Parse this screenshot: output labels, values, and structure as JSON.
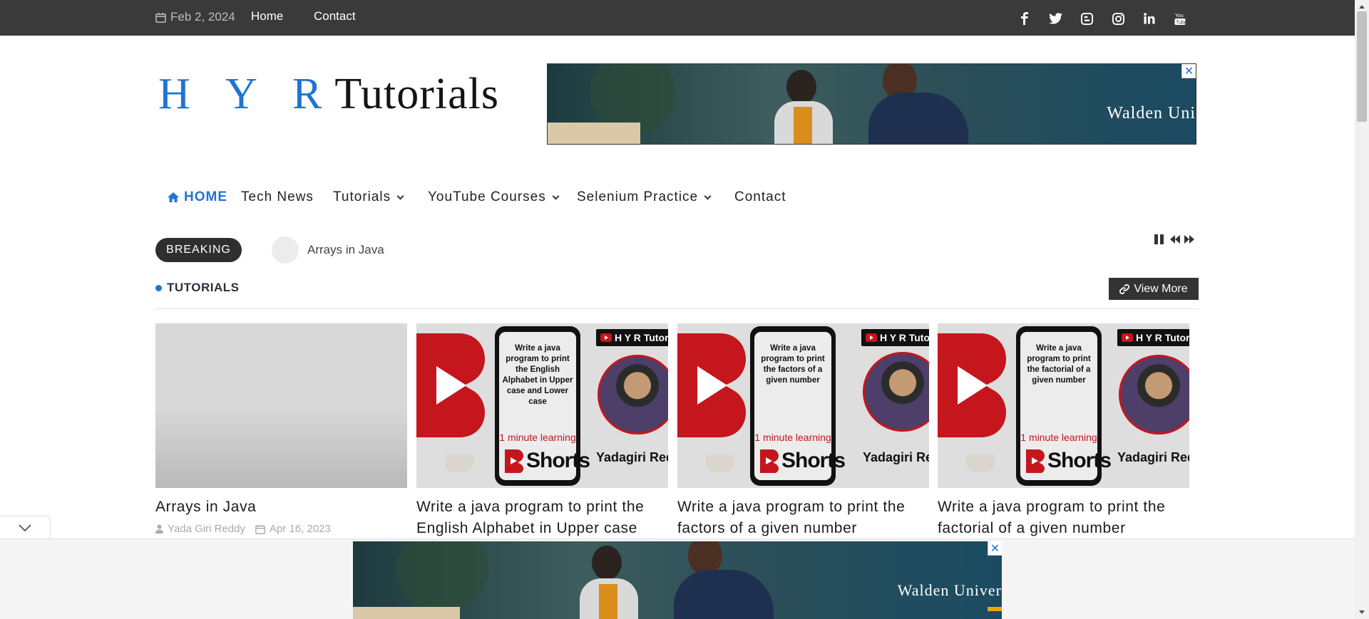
{
  "topbar": {
    "date": "Feb 2, 2024",
    "links": [
      "Home",
      "Contact"
    ],
    "social_icons": [
      "facebook-icon",
      "twitter-icon",
      "blogger-icon",
      "instagram-icon",
      "linkedin-icon",
      "youtube-icon"
    ]
  },
  "header": {
    "logo_letters": "H Y R",
    "logo_word": "Tutorials",
    "ad_brand": "Walden Uni",
    "ad_close": "✕"
  },
  "nav": {
    "items": [
      {
        "label": "HOME",
        "active": true
      },
      {
        "label": "Tech News"
      },
      {
        "label": "Tutorials"
      },
      {
        "label": "YouTube Courses"
      },
      {
        "label": "Selenium Practice"
      },
      {
        "label": "Contact"
      }
    ]
  },
  "breaking": {
    "label": "BREAKING",
    "text": "Arrays in Java"
  },
  "section": {
    "title": "TUTORIALS",
    "view_more": "View More"
  },
  "cards": [
    {
      "title": "Arrays in Java",
      "author": "Yada Giri Reddy",
      "date": "Apr 16, 2023"
    },
    {
      "title": "Write a java program to print the English Alphabet in Upper case",
      "thumb_text": "Write a java program to print the English Alphabet in Upper case and Lower case",
      "one_min": "1 minute learning",
      "shorts": "Shorts",
      "badge": "H Y R Tutorials",
      "owner": "Yadagiri Reddy"
    },
    {
      "title": "Write a java program to print the factors of a given number",
      "thumb_text": "Write a java program to print the factors of a given number",
      "one_min": "1 minute learning",
      "shorts": "Shorts",
      "badge": "H Y R Tutorials",
      "owner": "Yadagiri Reddy"
    },
    {
      "title": "Write a java program to print the factorial of a given number",
      "thumb_text": "Write a java program to print the factorial of a given number",
      "one_min": "1 minute learning",
      "shorts": "Shorts",
      "badge": "H Y R Tutorials",
      "owner": "Yadagiri Reddy"
    }
  ],
  "bottom_ad": {
    "brand": "Walden Univer",
    "close": "✕"
  },
  "colors": {
    "accent": "#1f74d1",
    "topbar": "#3a3a3a",
    "youtube_red": "#c4161c"
  }
}
